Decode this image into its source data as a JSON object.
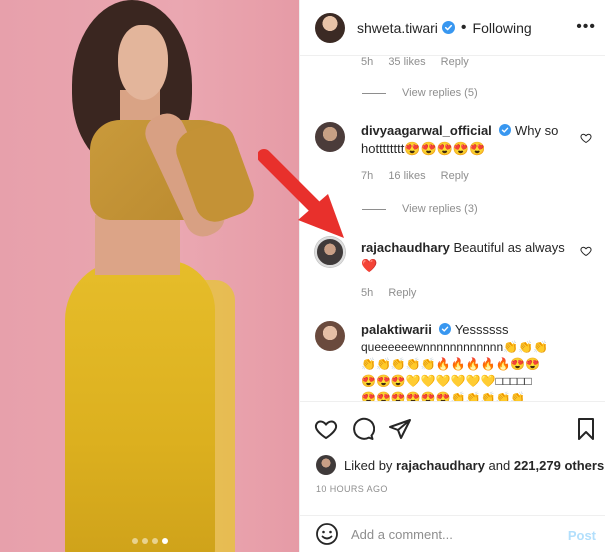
{
  "header": {
    "username": "shweta.tiwari",
    "separator": "•",
    "follow_status": "Following",
    "more": "•••"
  },
  "comments": {
    "top_meta": {
      "time": "5h",
      "likes": "35 likes",
      "reply": "Reply"
    },
    "view_replies_1": "View replies (5)",
    "c1": {
      "username": "divyaagarwal_official",
      "text": "Why so hotttttttt😍😍😍😍😍",
      "time": "7h",
      "likes": "16 likes",
      "reply": "Reply"
    },
    "view_replies_2": "View replies (3)",
    "c2": {
      "username": "rajachaudhary",
      "text": "Beautiful as always",
      "heart": "❤️",
      "time": "5h",
      "reply": "Reply"
    },
    "c3": {
      "username": "palaktiwarii",
      "text": "Yessssss",
      "line1": "queeeeeewnnnnnnnnnnnn👏👏👏",
      "line2": "👏👏👏👏👏🔥🔥🔥🔥🔥😍😍",
      "line3": "😍😍😍💛💛💛💛💛💛□□□□□",
      "line4": "😍😍😍😍😍😍👏👏👏👏👏"
    }
  },
  "likes": {
    "prefix": "Liked by ",
    "user": "rajachaudhary",
    "middle": " and ",
    "count": "221,279 others"
  },
  "time_ago": "10 HOURS AGO",
  "add_comment": {
    "placeholder": "Add a comment...",
    "post": "Post"
  },
  "colors": {
    "verified": "#3897f0",
    "arrow": "#e8302c",
    "post_disabled": "#b2dffc"
  }
}
